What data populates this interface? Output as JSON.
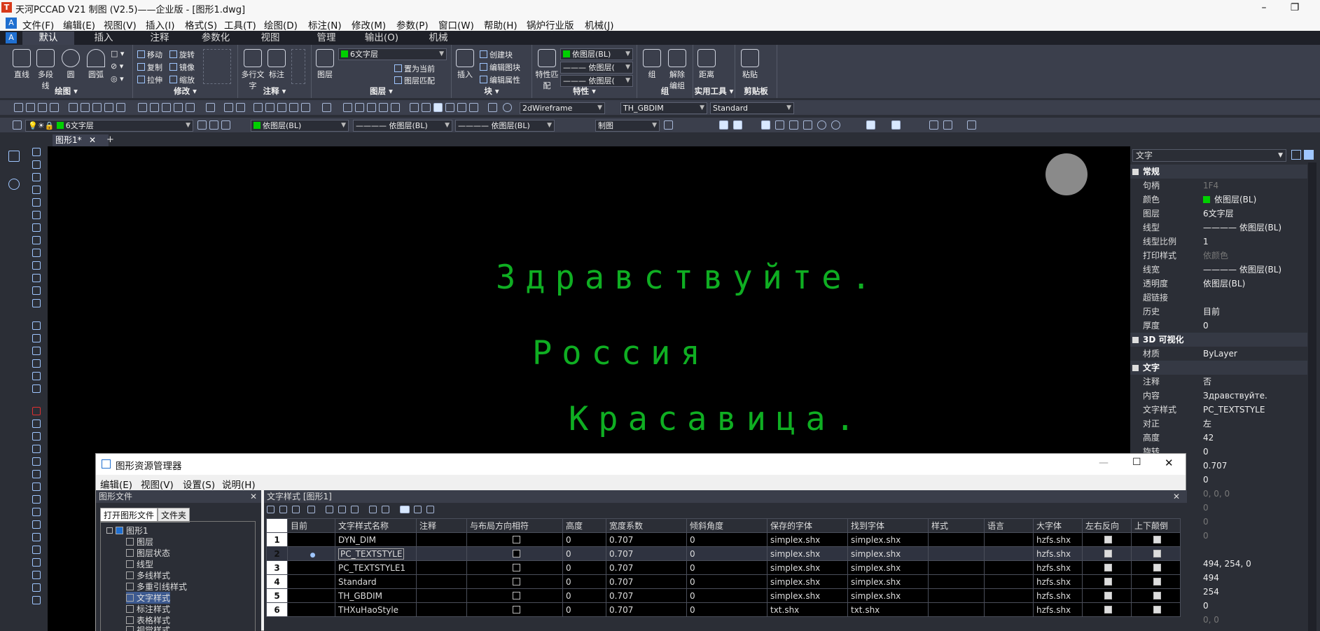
{
  "titlebar": {
    "logo": "T",
    "title": "天河PCCAD V21 制图 (V2.5)——企业版 - [图形1.dwg]",
    "minimize": "–",
    "restore": "❐"
  },
  "menubar": {
    "items": [
      "文件(F)",
      "编辑(E)",
      "视图(V)",
      "插入(I)",
      "格式(S)",
      "工具(T)",
      "绘图(D)",
      "标注(N)",
      "修改(M)",
      "参数(P)",
      "窗口(W)",
      "帮助(H)",
      "锅炉行业版",
      "机械(J)"
    ]
  },
  "ribbon_tabs": [
    "默认",
    "插入",
    "注释",
    "参数化",
    "视图",
    "管理",
    "输出(O)",
    "机械"
  ],
  "ribbon": {
    "draw": {
      "title": "绘图 ▾",
      "buttons": [
        "直线",
        "多段线",
        "圆",
        "圆弧"
      ],
      "tools": [
        "□ ▾",
        "⊘ ▾",
        "◎ ▾"
      ]
    },
    "modify": {
      "title": "修改 ▾",
      "items": [
        "移动",
        "旋转",
        "复制",
        "镜像",
        "拉伸",
        "缩放"
      ]
    },
    "annotate": {
      "title": "注释 ▾",
      "buttons": [
        "多行文字",
        "标注"
      ]
    },
    "layers": {
      "title": "图层 ▾",
      "button": "图层",
      "current_layer": "6文字层",
      "items": [
        "置为当前",
        "图层匹配"
      ]
    },
    "block": {
      "title": "块 ▾",
      "button": "插入",
      "items": [
        "创建块",
        "编辑图块",
        "编辑属性"
      ]
    },
    "properties": {
      "title": "特性 ▾",
      "button": "特性匹配",
      "color": "依图层(BL)",
      "linetype": "依图层(",
      "lineweight": "依图层("
    },
    "group": {
      "title": "组",
      "buttons": [
        "组",
        "解除编组"
      ]
    },
    "utilities": {
      "title": "实用工具 ▾",
      "button": "距离"
    },
    "clipboard": {
      "title": "剪贴板",
      "button": "粘贴"
    }
  },
  "toolbar1": {
    "visual_style": "2dWireframe",
    "dim_style": "TH_GBDIM",
    "text_style": "Standard"
  },
  "toolbar2": {
    "layer": "6文字层",
    "color": "依图层(BL)",
    "linetype": "依图层(BL)",
    "lineweight": "依图层(BL)",
    "plotstyle": "制图"
  },
  "doc_tab": {
    "label": "图形1*",
    "close": "✕",
    "add": "+"
  },
  "canvas_text": [
    "Здравствуйте.",
    "Россия",
    "Красавица."
  ],
  "properties": {
    "selector": "文字",
    "sections": {
      "general": "常规",
      "viz3d": "3D 可视化",
      "text": "文字"
    },
    "general_rows": [
      {
        "k": "句柄",
        "v": "1F4"
      },
      {
        "k": "颜色",
        "v": "依图层(BL)"
      },
      {
        "k": "图层",
        "v": "6文字层"
      },
      {
        "k": "线型",
        "v": "———— 依图层(BL)"
      },
      {
        "k": "线型比例",
        "v": "1"
      },
      {
        "k": "打印样式",
        "v": "依颜色"
      },
      {
        "k": "线宽",
        "v": "———— 依图层(BL)"
      },
      {
        "k": "透明度",
        "v": "依图层(BL)"
      },
      {
        "k": "超链接",
        "v": ""
      },
      {
        "k": "历史",
        "v": "目前"
      },
      {
        "k": "厚度",
        "v": "0"
      }
    ],
    "viz_rows": [
      {
        "k": "材质",
        "v": "ByLayer"
      }
    ],
    "text_rows": [
      {
        "k": "注释",
        "v": "否"
      },
      {
        "k": "内容",
        "v": "Здравствуйте."
      },
      {
        "k": "文字样式",
        "v": "PC_TEXTSTYLE"
      },
      {
        "k": "对正",
        "v": "左"
      },
      {
        "k": "高度",
        "v": "42"
      },
      {
        "k": "旋转",
        "v": "0"
      }
    ],
    "hidden_values": [
      "0.707",
      "0",
      "0, 0, 0",
      "0",
      "0",
      "0",
      "",
      "494, 254, 0",
      "494",
      "254",
      "0",
      "0, 0"
    ]
  },
  "dialog": {
    "title": "图形资源管理器",
    "menu": [
      "编辑(E)",
      "视图(V)",
      "设置(S)",
      "说明(H)"
    ],
    "left_header": "图形文件",
    "left_tabs": [
      "打开图形文件",
      "文件夹"
    ],
    "tree": [
      "图形1",
      "图层",
      "图层状态",
      "线型",
      "多线样式",
      "多重引线样式",
      "文字样式",
      "标注样式",
      "表格样式",
      "视觉样式"
    ],
    "right_header": "文字样式 [图形1]",
    "columns": [
      "目前",
      "文字样式名称",
      "注释",
      "与布局方向相符",
      "高度",
      "宽度系数",
      "倾斜角度",
      "保存的字体",
      "找到字体",
      "样式",
      "语言",
      "大字体",
      "左右反向",
      "上下颠倒"
    ],
    "rows": [
      {
        "n": "1",
        "name": "DYN_DIM",
        "h": "0",
        "w": "0.707",
        "a": "0",
        "saved": "simplex.shx",
        "found": "simplex.shx",
        "big": "hzfs.shx"
      },
      {
        "n": "2",
        "name": "PC_TEXTSTYLE",
        "h": "0",
        "w": "0.707",
        "a": "0",
        "saved": "simplex.shx",
        "found": "simplex.shx",
        "big": "hzfs.shx"
      },
      {
        "n": "3",
        "name": "PC_TEXTSTYLE1",
        "h": "0",
        "w": "0.707",
        "a": "0",
        "saved": "simplex.shx",
        "found": "simplex.shx",
        "big": "hzfs.shx"
      },
      {
        "n": "4",
        "name": "Standard",
        "h": "0",
        "w": "0.707",
        "a": "0",
        "saved": "simplex.shx",
        "found": "simplex.shx",
        "big": "hzfs.shx"
      },
      {
        "n": "5",
        "name": "TH_GBDIM",
        "h": "0",
        "w": "0.707",
        "a": "0",
        "saved": "simplex.shx",
        "found": "simplex.shx",
        "big": "hzfs.shx"
      },
      {
        "n": "6",
        "name": "THXuHaoStyle",
        "h": "0",
        "w": "0.707",
        "a": "0",
        "saved": "txt.shx",
        "found": "txt.shx",
        "big": "hzfs.shx"
      }
    ],
    "current_row": "2",
    "ctl": {
      "min": "—",
      "max": "☐",
      "close": "✕"
    }
  },
  "colors": {
    "canvas": "#000000",
    "text_green": "#0fae22",
    "panel": "#2b2e36",
    "ribbon": "#3b3f4c",
    "accent": "#1f6fd0"
  }
}
